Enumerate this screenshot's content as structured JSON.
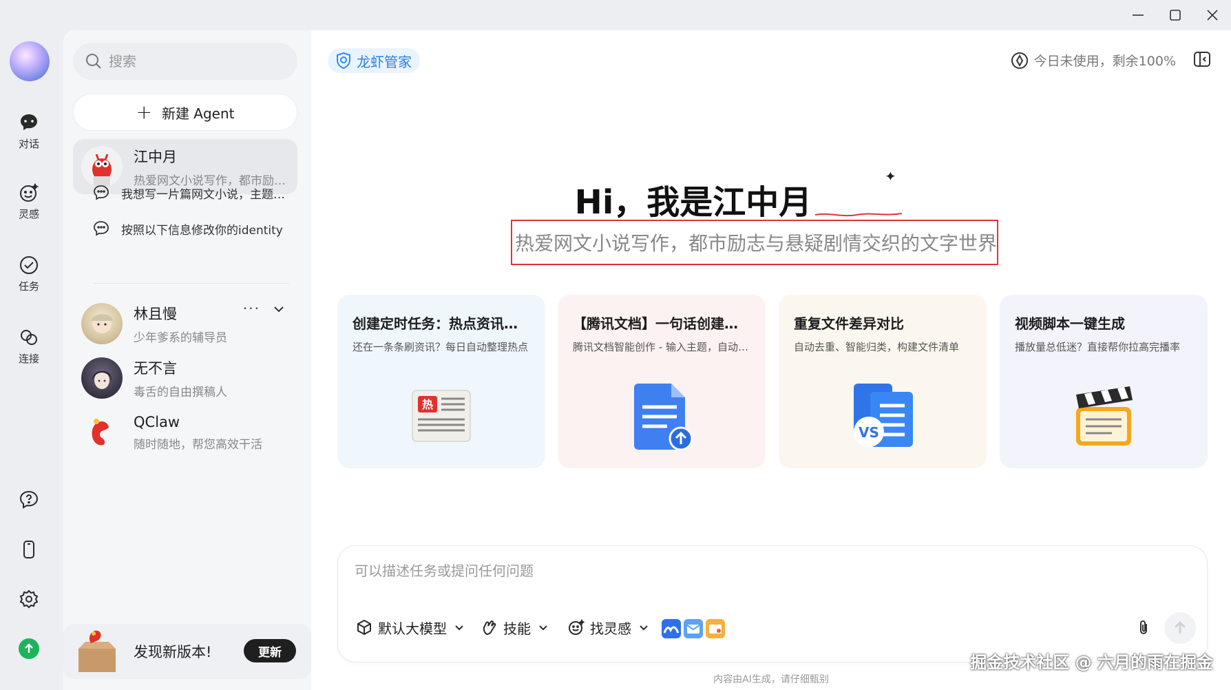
{
  "rail": {
    "items": [
      {
        "label": "对话",
        "icon": "chat-bubble-icon"
      },
      {
        "label": "灵感",
        "icon": "smile-sparkle-icon"
      },
      {
        "label": "任务",
        "icon": "check-circle-icon"
      },
      {
        "label": "连接",
        "icon": "link-icon"
      }
    ]
  },
  "sidebar": {
    "search_placeholder": "搜索",
    "new_agent_label": "新建 Agent",
    "agents": [
      {
        "name": "江中月",
        "desc": "热爱网文小说写作，都市励志与悬疑剧情交织的文字世界"
      },
      {
        "name": "林且慢",
        "desc": "少年爹系的辅导员"
      },
      {
        "name": "无不言",
        "desc": "毒舌的自由撰稿人"
      },
      {
        "name": "QClaw",
        "desc": "随时随地，帮您高效干活"
      }
    ],
    "conversations": [
      {
        "title": "我想写一片篇网文小说，主题是都市励志"
      },
      {
        "title": "按照以下信息修改你的identity"
      }
    ],
    "agent_more": "···",
    "update": {
      "text": "发现新版本!",
      "button": "更新"
    }
  },
  "main": {
    "brand": "龙虾管家",
    "quota": "今日未使用，剩余100%",
    "hero_title": "Hi，我是江中月",
    "hero_subtitle": "热爱网文小说写作，都市励志与悬疑剧情交织的文字世界",
    "cards": [
      {
        "title": "创建定时任务：热点资讯日报",
        "desc": "还在一条条刷资讯？每日自动整理热点",
        "bg": "#eff6fc"
      },
      {
        "title": "【腾讯文档】一句话创建文档",
        "desc": "腾讯文档智能创作 - 输入主题，自动生成",
        "bg": "#fdf2f2"
      },
      {
        "title": "重复文件差异对比",
        "desc": "自动去重、智能归类，构建文件清单",
        "bg": "#fcf7ee"
      },
      {
        "title": "视频脚本一键生成",
        "desc": "播放量总低迷？直接帮你拉高完播率",
        "bg": "#f3f3fb"
      }
    ],
    "composer": {
      "placeholder": "可以描述任务或提问任何问题",
      "model": "默认大模型",
      "skills": "技能",
      "inspiration": "找灵感"
    },
    "disclaimer": "内容由AI生成，请仔细甄别",
    "watermark": "掘金技术社区 @ 六月的雨在掘金"
  },
  "colors": {
    "accent": "#2a7fe0",
    "highlight_box": "#e0323d",
    "update_green": "#1fb35a"
  }
}
